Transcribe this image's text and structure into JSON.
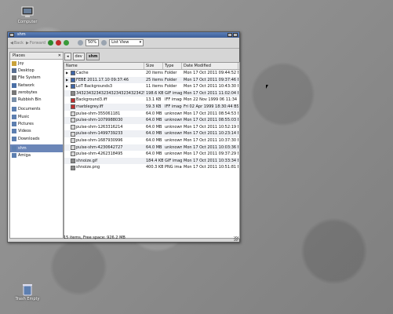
{
  "desktop": {
    "top_icon_label": "Computer",
    "bottom_icon_label": "Trash Empty"
  },
  "window": {
    "title": "shm",
    "toolbar": {
      "back_label": "Back",
      "forward_label": "Forward",
      "zoom_value": "50%",
      "view_mode": "List View"
    },
    "path": [
      "dev",
      "shm"
    ],
    "places": {
      "header": "Places",
      "items": [
        {
          "label": "Joy",
          "icon": "home-icon"
        },
        {
          "label": "Desktop",
          "icon": "desktop-icon"
        },
        {
          "label": "File System",
          "icon": "drive-icon"
        },
        {
          "label": "Network",
          "icon": "network-icon"
        },
        {
          "label": "zerobytes",
          "icon": "drive-icon"
        },
        {
          "label": "Rubbish Bin",
          "icon": "trash-icon"
        },
        {
          "label": "Documents",
          "icon": "folder-icon"
        },
        {
          "label": "Music",
          "icon": "folder-icon"
        },
        {
          "label": "Pictures",
          "icon": "folder-icon"
        },
        {
          "label": "Videos",
          "icon": "folder-icon"
        },
        {
          "label": "Downloads",
          "icon": "folder-icon"
        },
        {
          "label": "shm",
          "icon": "folder-icon"
        },
        {
          "label": "Amiga",
          "icon": "folder-icon"
        }
      ],
      "selected": "shm"
    },
    "columns": [
      "Name",
      "Size",
      "Type",
      "Date Modified"
    ],
    "files": [
      {
        "name": "Cache",
        "size": "20 items",
        "type": "Folder",
        "date": "Mon 17 Oct 2011 09:44:52 BST",
        "icon": "folder-icon",
        "expandable": true
      },
      {
        "name": "FEBE 2011.17.10 09:37:46",
        "size": "25 items",
        "type": "Folder",
        "date": "Mon 17 Oct 2011 09:37:46 BST",
        "icon": "folder-icon",
        "expandable": true
      },
      {
        "name": "LoT Backgrounds3",
        "size": "11 items",
        "type": "Folder",
        "date": "Mon 17 Oct 2011 10:43:30 BST",
        "icon": "folder-icon",
        "expandable": true
      },
      {
        "name": "3432343234323432343234323425.gif",
        "size": "198.6 KB",
        "type": "GIF image",
        "date": "Mon 17 Oct 2011 11:02:04 BST",
        "icon": "image-icon",
        "expandable": false
      },
      {
        "name": "Background3.iff",
        "size": "13.1 KB",
        "type": "IFF image",
        "date": "Mon 22 Nov 1999 06 11:34 GMT",
        "icon": "iff-icon",
        "expandable": false
      },
      {
        "name": "marblegrey.iff",
        "size": "59.3 KB",
        "type": "IFF image",
        "date": "Fri 02 Apr 1999 18:30:44 BST",
        "icon": "iff-icon",
        "expandable": false
      },
      {
        "name": "pulse-shm-355061181",
        "size": "64.0 MB",
        "type": "unknown",
        "date": "Mon 17 Oct 2011 08:54:53 BST",
        "icon": "file-icon",
        "expandable": false
      },
      {
        "name": "pulse-shm-1079988030",
        "size": "64.0 MB",
        "type": "unknown",
        "date": "Mon 17 Oct 2011 08:55:03 BST",
        "icon": "file-icon",
        "expandable": false
      },
      {
        "name": "pulse-shm-1263316214",
        "size": "64.0 MB",
        "type": "unknown",
        "date": "Mon 17 Oct 2011 10:52:19 BST",
        "icon": "file-icon",
        "expandable": false
      },
      {
        "name": "pulse-shm-1499739233",
        "size": "64.0 MB",
        "type": "unknown",
        "date": "Mon 17 Oct 2011 10:23:14 BST",
        "icon": "file-icon",
        "expandable": false
      },
      {
        "name": "pulse-shm-1687930996",
        "size": "64.0 MB",
        "type": "unknown",
        "date": "Mon 17 Oct 2011 10:37:30 BST",
        "icon": "file-icon",
        "expandable": false
      },
      {
        "name": "pulse-shm-4230642727",
        "size": "64.0 MB",
        "type": "unknown",
        "date": "Mon 17 Oct 2011 10:03:36 BST",
        "icon": "file-icon",
        "expandable": false
      },
      {
        "name": "pulse-shm-4262318495",
        "size": "64.0 MB",
        "type": "unknown",
        "date": "Mon 17 Oct 2011 09:37:29 BST",
        "icon": "file-icon",
        "expandable": false
      },
      {
        "name": "shnoize.gif",
        "size": "184.4 KB",
        "type": "GIF image",
        "date": "Mon 17 Oct 2011 10:33:34 BST",
        "icon": "image-icon",
        "expandable": false
      },
      {
        "name": "shnoize.png",
        "size": "400.3 KB",
        "type": "PNG image",
        "date": "Mon 17 Oct 2011 10:51:81 BST",
        "icon": "image-icon",
        "expandable": false
      }
    ],
    "status": "15 items, Free space: 926.2 MB"
  }
}
